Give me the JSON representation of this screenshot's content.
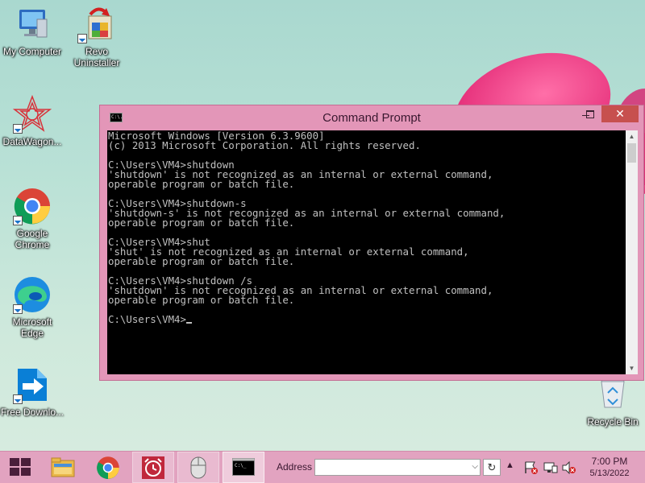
{
  "desktop": {
    "icons": [
      {
        "label": "My Computer",
        "icon": "computer-icon"
      },
      {
        "label": "Revo Uninstaller",
        "icon": "revo-uninstaller-icon"
      },
      {
        "label": "DataWagon...",
        "icon": "datawagon-icon"
      },
      {
        "label": "Google Chrome",
        "icon": "chrome-icon"
      },
      {
        "label": "Microsoft Edge",
        "icon": "edge-icon"
      },
      {
        "label": "Free Downlo...",
        "icon": "free-download-icon"
      },
      {
        "label": "Recycle Bin",
        "icon": "recycle-bin-icon"
      }
    ]
  },
  "window": {
    "title": "Command Prompt",
    "icon_text": "C:\\.",
    "close_glyph": "✕",
    "scroll_up": "▲",
    "scroll_down": "▼",
    "console_lines": [
      "Microsoft Windows [Version 6.3.9600]",
      "(c) 2013 Microsoft Corporation. All rights reserved.",
      "",
      "C:\\Users\\VM4>shutdown",
      "'shutdown' is not recognized as an internal or external command,",
      "operable program or batch file.",
      "",
      "C:\\Users\\VM4>shutdown-s",
      "'shutdown-s' is not recognized as an internal or external command,",
      "operable program or batch file.",
      "",
      "C:\\Users\\VM4>shut",
      "'shut' is not recognized as an internal or external command,",
      "operable program or batch file.",
      "",
      "C:\\Users\\VM4>shutdown /s",
      "'shutdown' is not recognized as an internal or external command,",
      "operable program or batch file.",
      "",
      "C:\\Users\\VM4>"
    ]
  },
  "taskbar": {
    "address_label": "Address",
    "address_value": "",
    "address_dropdown": "⌵",
    "address_go": "↻",
    "tray_chevron": "▲",
    "time": "7:00 PM",
    "date": "5/13/2022"
  },
  "colors": {
    "window_frame": "#e396b8",
    "close_button": "#c7504e",
    "taskbar": "#e2a3c0",
    "console_bg": "#000000",
    "console_text": "#c0c0c0"
  }
}
